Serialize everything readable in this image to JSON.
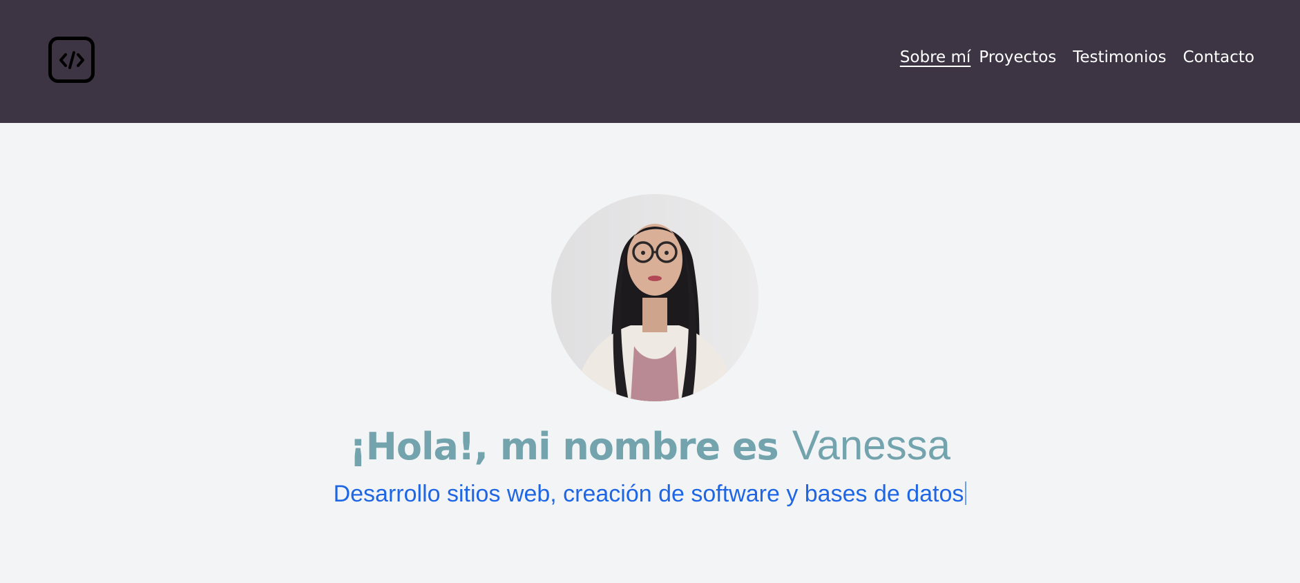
{
  "header": {
    "logo_icon": "code-brackets-icon",
    "nav": {
      "about": "Sobre mí",
      "projects": "Proyectos",
      "testimonials": "Testimonios",
      "contact": "Contacto"
    }
  },
  "hero": {
    "avatar_icon": "profile-photo",
    "greeting": "¡Hola!, mi nombre es",
    "name": "Vanessa",
    "subtitle": "Desarrollo sitios web, creación de software y bases de datos"
  },
  "colors": {
    "header_bg": "#3d3543",
    "page_bg": "#f3f4f6",
    "title_color": "#73a3ad",
    "subtitle_color": "#1f66e5",
    "nav_text": "#ffffff"
  }
}
